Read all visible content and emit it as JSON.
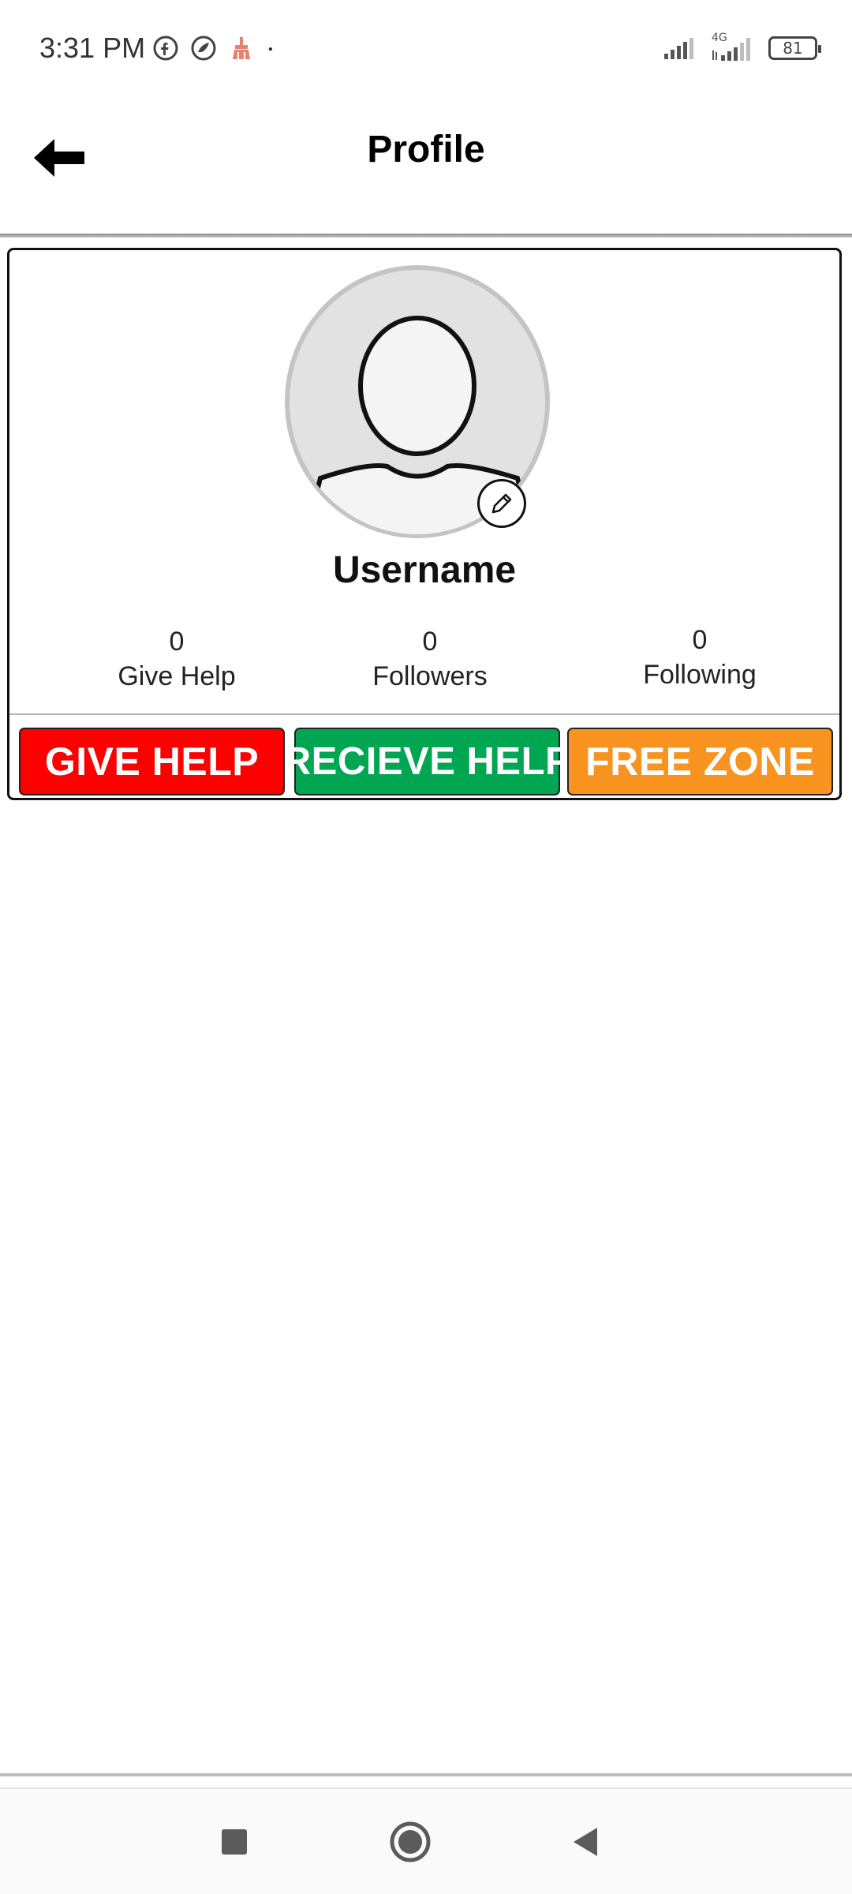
{
  "status_bar": {
    "time": "3:31 PM",
    "network_label": "4G",
    "battery_level": "81",
    "icons": [
      "facebook-icon",
      "browser-icon",
      "cleaner-icon",
      "dot-icon",
      "signal-icon",
      "signal-4g-icon",
      "battery-icon"
    ]
  },
  "app_bar": {
    "title": "Profile",
    "back_icon": "arrow-left-icon"
  },
  "profile": {
    "username": "Username",
    "avatar_icon": "default-avatar-icon",
    "edit_icon": "pencil-icon",
    "stats": [
      {
        "value": "0",
        "label": "Give Help"
      },
      {
        "value": "0",
        "label": "Followers"
      },
      {
        "value": "0",
        "label": "Following"
      }
    ]
  },
  "actions": {
    "give_help": "GIVE HELP",
    "recieve_help": "RECIEVE HELP",
    "free_zone": "FREE ZONE"
  },
  "colors": {
    "give_help": "#ff0000",
    "recieve_help": "#00a651",
    "free_zone": "#f7931e"
  },
  "nav": {
    "icons": [
      "recents-square-icon",
      "home-circle-icon",
      "back-triangle-icon"
    ]
  }
}
